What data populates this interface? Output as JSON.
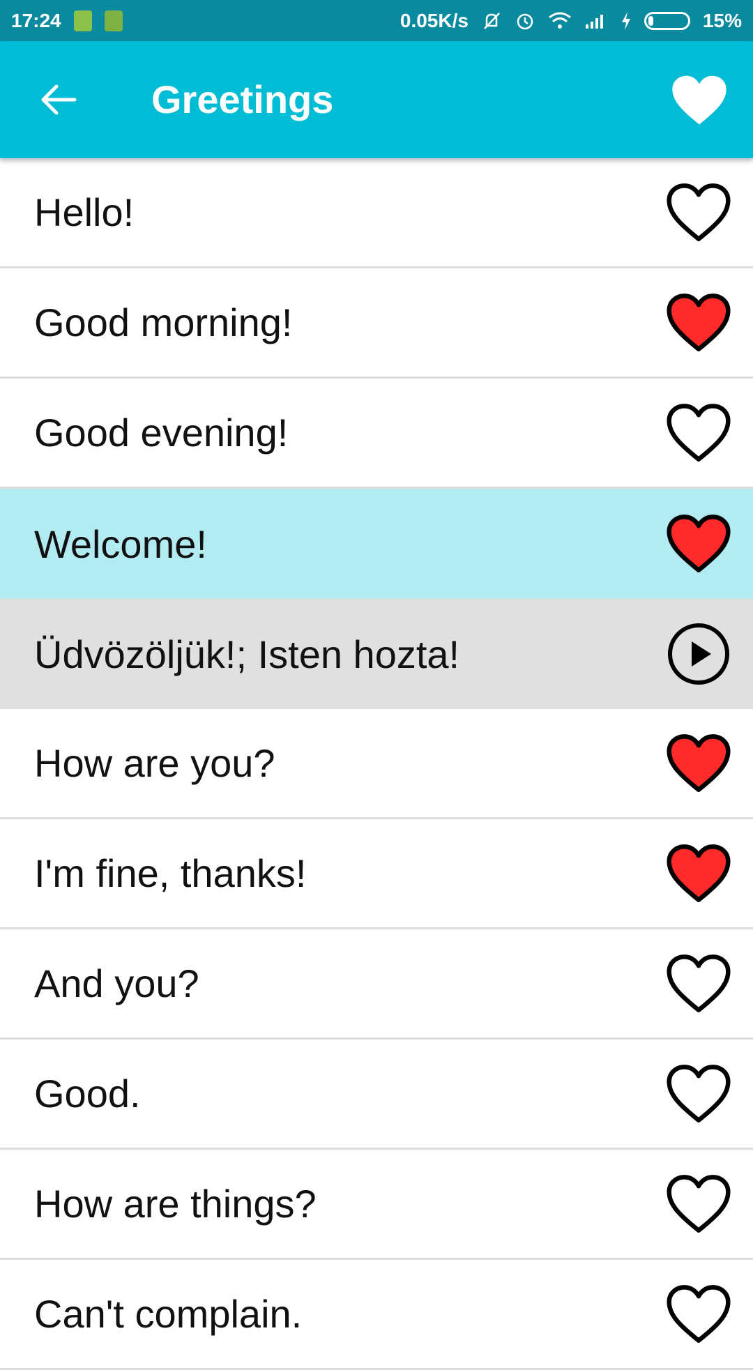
{
  "status_bar": {
    "time": "17:24",
    "net_speed": "0.05K/s",
    "battery_percent": "15%",
    "battery_level": 0.15,
    "icons": [
      "battery-notify-icon",
      "android-icon",
      "mute-icon",
      "alarm-icon",
      "wifi-icon",
      "signal-icon",
      "charging-icon",
      "battery-icon"
    ]
  },
  "app_bar": {
    "title": "Greetings",
    "back_icon": "arrow-left-icon",
    "favorites_icon": "heart-filled-icon"
  },
  "colors": {
    "status_bar": "#0a8a9f",
    "app_bar": "#00bcd4",
    "selected_row": "#b2ebf2",
    "translation_row": "#e0e0e0",
    "heart_red": "#ff2a2a"
  },
  "phrases": [
    {
      "label": "Hello!",
      "favorite": false
    },
    {
      "label": "Good morning!",
      "favorite": true
    },
    {
      "label": "Good evening!",
      "favorite": false
    },
    {
      "label": "Welcome!",
      "favorite": true,
      "selected": true
    },
    {
      "label": "Üdvözöljük!; Isten hozta!",
      "translation": true,
      "icon": "play-icon"
    },
    {
      "label": "How are you?",
      "favorite": true
    },
    {
      "label": "I'm fine, thanks!",
      "favorite": true
    },
    {
      "label": "And you?",
      "favorite": false
    },
    {
      "label": "Good.",
      "favorite": false
    },
    {
      "label": "How are things?",
      "favorite": false
    },
    {
      "label": "Can't complain.",
      "favorite": false
    }
  ]
}
